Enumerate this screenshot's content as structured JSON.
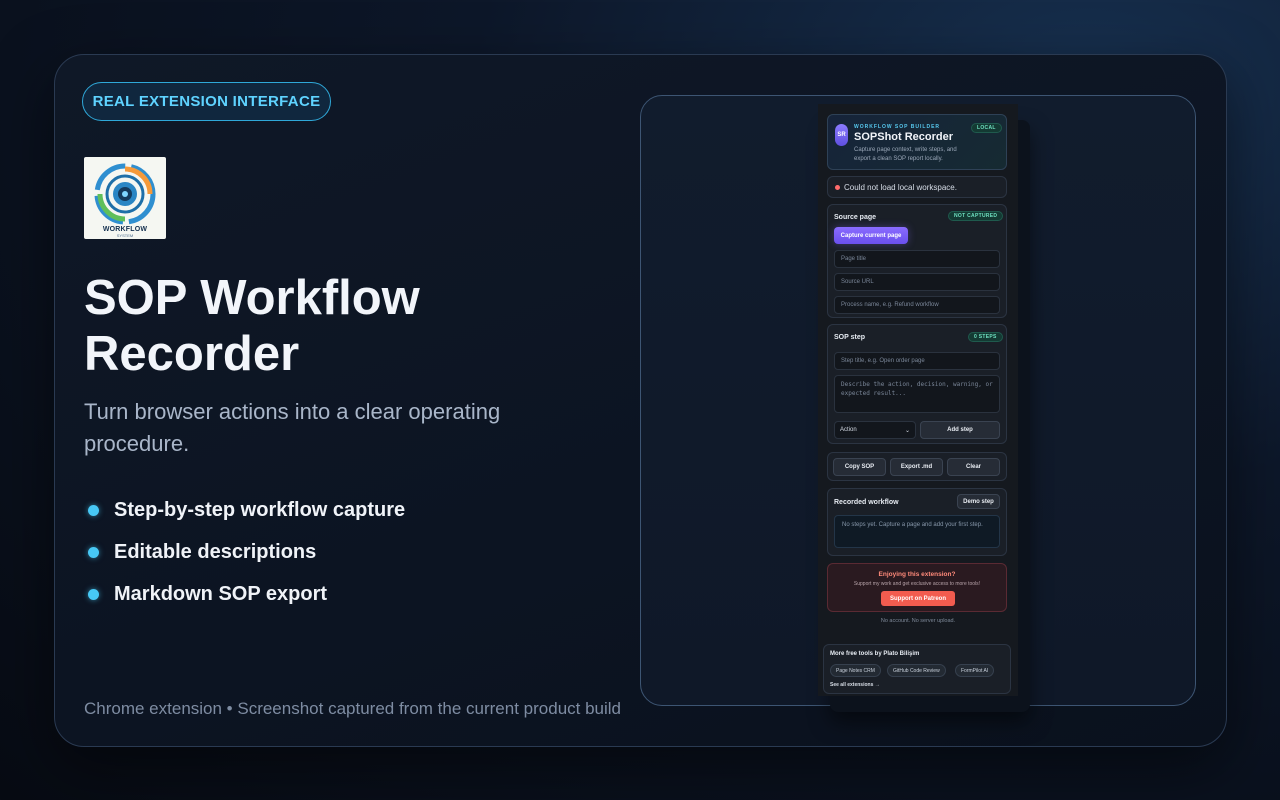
{
  "badge": "REAL EXTENSION INTERFACE",
  "logo": {
    "text": "WORKFLOW",
    "subtext": "SYSTEM"
  },
  "title": "SOP Workflow Recorder",
  "subtitle": "Turn browser actions into a clear operating procedure.",
  "features": [
    "Step-by-step workflow capture",
    "Editable descriptions",
    "Markdown SOP export"
  ],
  "footer_note": "Chrome extension • Screenshot captured from the current product build",
  "colors": {
    "accent": "#47c8f5",
    "primary_button": "#7a5cf5",
    "support": "#f25c4f"
  },
  "extension": {
    "header": {
      "avatar": "SR",
      "kicker": "WORKFLOW SOP BUILDER",
      "title": "SOPShot Recorder",
      "description": "Capture page context, write steps, and export a clean SOP report locally.",
      "badge": "LOCAL"
    },
    "alert": "Could not load local workspace.",
    "source": {
      "title": "Source page",
      "status": "NOT CAPTURED",
      "capture_button": "Capture current page",
      "page_title_placeholder": "Page title",
      "url_placeholder": "Source URL",
      "process_placeholder": "Process name, e.g. Refund workflow"
    },
    "step": {
      "title": "SOP step",
      "count": "0 STEPS",
      "title_placeholder": "Step title, e.g. Open order page",
      "desc_placeholder": "Describe the action, decision, warning, or expected result...",
      "type_selected": "Action",
      "add_button": "Add step"
    },
    "actions": {
      "copy": "Copy SOP",
      "export": "Export .md",
      "clear": "Clear"
    },
    "recorded": {
      "title": "Recorded workflow",
      "demo_button": "Demo step",
      "empty": "No steps yet. Capture a page and add your first step."
    },
    "support": {
      "title": "Enjoying this extension?",
      "description": "Support my work and get exclusive access to more tools!",
      "button": "Support on Patreon"
    },
    "privacy": "No account. No server upload.",
    "more": {
      "title": "More free tools by Plato Bilişim",
      "chips": [
        "Page Notes CRM",
        "GitHub Code Review",
        "FormPilot AI"
      ],
      "link": "See all extensions →"
    }
  }
}
